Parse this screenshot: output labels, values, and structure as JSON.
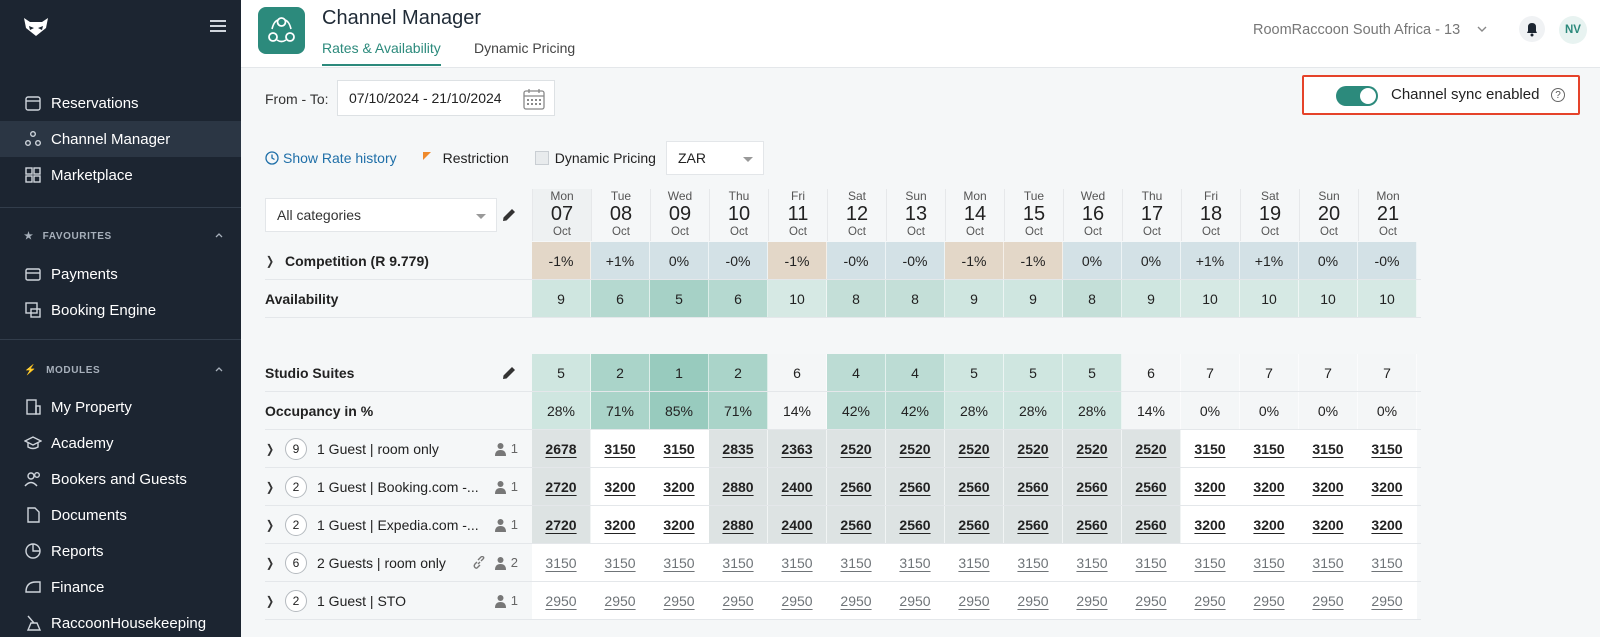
{
  "sidebar": {
    "nav_top": [
      "Reservations",
      "Channel Manager",
      "Marketplace"
    ],
    "favourites_title": "FAVOURITES",
    "favourites": [
      "Payments",
      "Booking Engine"
    ],
    "modules_title": "MODULES",
    "modules": [
      "My Property",
      "Academy",
      "Bookers and Guests",
      "Documents",
      "Reports",
      "Finance",
      "RaccoonHousekeeping"
    ]
  },
  "header": {
    "title": "Channel Manager",
    "tabs": [
      "Rates & Availability",
      "Dynamic Pricing"
    ],
    "property": "RoomRaccoon South Africa - 13",
    "avatar": "NV"
  },
  "controls": {
    "from_to_label": "From - To:",
    "date_range": "07/10/2024 - 21/10/2024",
    "sync_label": "Channel sync enabled",
    "sync_enabled": true,
    "show_rate_history": "Show Rate history",
    "restriction": "Restriction",
    "dynamic_pricing": "Dynamic Pricing",
    "currency": "ZAR",
    "category": "All categories"
  },
  "days": [
    {
      "dn": "Mon",
      "dd": "07",
      "dm": "Oct"
    },
    {
      "dn": "Tue",
      "dd": "08",
      "dm": "Oct"
    },
    {
      "dn": "Wed",
      "dd": "09",
      "dm": "Oct"
    },
    {
      "dn": "Thu",
      "dd": "10",
      "dm": "Oct"
    },
    {
      "dn": "Fri",
      "dd": "11",
      "dm": "Oct"
    },
    {
      "dn": "Sat",
      "dd": "12",
      "dm": "Oct"
    },
    {
      "dn": "Sun",
      "dd": "13",
      "dm": "Oct"
    },
    {
      "dn": "Mon",
      "dd": "14",
      "dm": "Oct"
    },
    {
      "dn": "Tue",
      "dd": "15",
      "dm": "Oct"
    },
    {
      "dn": "Wed",
      "dd": "16",
      "dm": "Oct"
    },
    {
      "dn": "Thu",
      "dd": "17",
      "dm": "Oct"
    },
    {
      "dn": "Fri",
      "dd": "18",
      "dm": "Oct"
    },
    {
      "dn": "Sat",
      "dd": "19",
      "dm": "Oct"
    },
    {
      "dn": "Sun",
      "dd": "20",
      "dm": "Oct"
    },
    {
      "dn": "Mon",
      "dd": "21",
      "dm": "Oct"
    }
  ],
  "rows": {
    "competition": {
      "label": "Competition (R 9.779)",
      "values": [
        "-1%",
        "+1%",
        "0%",
        "-0%",
        "-1%",
        "-0%",
        "-0%",
        "-1%",
        "-1%",
        "0%",
        "0%",
        "+1%",
        "+1%",
        "0%",
        "-0%"
      ],
      "colors": [
        "#e3d7c8",
        "#d3e1e6",
        "#d3e1e6",
        "#d3e1e6",
        "#e3d7c8",
        "#d3e1e6",
        "#d3e1e6",
        "#e3d7c8",
        "#e3d7c8",
        "#d3e1e6",
        "#d3e1e6",
        "#d3e1e6",
        "#d3e1e6",
        "#d3e1e6",
        "#d3e1e6"
      ]
    },
    "availability": {
      "label": "Availability",
      "values": [
        "9",
        "6",
        "5",
        "6",
        "10",
        "8",
        "8",
        "9",
        "9",
        "8",
        "9",
        "10",
        "10",
        "10",
        "10"
      ],
      "colors": [
        "#cfe6e0",
        "#b5d9d0",
        "#a6d1c6",
        "#b5d9d0",
        "#d6e9e4",
        "#c4dfd8",
        "#c4dfd8",
        "#cfe6e0",
        "#cfe6e0",
        "#c4dfd8",
        "#cfe6e0",
        "#d6e9e4",
        "#d6e9e4",
        "#d6e9e4",
        "#d6e9e4"
      ]
    },
    "studio": {
      "label": "Studio Suites",
      "values": [
        "5",
        "2",
        "1",
        "2",
        "6",
        "4",
        "4",
        "5",
        "5",
        "5",
        "6",
        "7",
        "7",
        "7",
        "7"
      ],
      "colors": [
        "#cfe6e0",
        "#aad4c9",
        "#98cbbe",
        "#aad4c9",
        "#f4f6f7",
        "#bcdcd4",
        "#bcdcd4",
        "#cfe6e0",
        "#cfe6e0",
        "#cfe6e0",
        "#f4f6f7",
        "#f4f6f7",
        "#f4f6f7",
        "#f4f6f7",
        "#f4f6f7"
      ]
    },
    "occupancy": {
      "label": "Occupancy in %",
      "values": [
        "28%",
        "71%",
        "85%",
        "71%",
        "14%",
        "42%",
        "42%",
        "28%",
        "28%",
        "28%",
        "14%",
        "0%",
        "0%",
        "0%",
        "0%"
      ],
      "colors": [
        "#cfe6e0",
        "#aad4c9",
        "#98cbbe",
        "#aad4c9",
        "#f4f6f7",
        "#bcdcd4",
        "#bcdcd4",
        "#cfe6e0",
        "#cfe6e0",
        "#cfe6e0",
        "#f4f6f7",
        "#f4f6f7",
        "#f4f6f7",
        "#f4f6f7",
        "#f4f6f7"
      ]
    }
  },
  "rates": [
    {
      "badge": "9",
      "label": "1 Guest | room only",
      "occ": "1",
      "link": false,
      "style": "b",
      "values": [
        "2678",
        "3150",
        "3150",
        "2835",
        "2363",
        "2520",
        "2520",
        "2520",
        "2520",
        "2520",
        "2520",
        "3150",
        "3150",
        "3150",
        "3150"
      ],
      "colors": [
        "#dde3e3",
        "#ffffff",
        "#ffffff",
        "#dde3e3",
        "#dde3e3",
        "#dde3e3",
        "#dde3e3",
        "#dde3e3",
        "#dde3e3",
        "#dde3e3",
        "#dde3e3",
        "#ffffff",
        "#ffffff",
        "#ffffff",
        "#ffffff"
      ]
    },
    {
      "badge": "2",
      "label": "1 Guest | Booking.com -...",
      "occ": "1",
      "link": false,
      "style": "b",
      "values": [
        "2720",
        "3200",
        "3200",
        "2880",
        "2400",
        "2560",
        "2560",
        "2560",
        "2560",
        "2560",
        "2560",
        "3200",
        "3200",
        "3200",
        "3200"
      ],
      "colors": [
        "#dde3e3",
        "#ffffff",
        "#ffffff",
        "#dde3e3",
        "#dde3e3",
        "#dde3e3",
        "#dde3e3",
        "#dde3e3",
        "#dde3e3",
        "#dde3e3",
        "#dde3e3",
        "#ffffff",
        "#ffffff",
        "#ffffff",
        "#ffffff"
      ]
    },
    {
      "badge": "2",
      "label": "1 Guest | Expedia.com -...",
      "occ": "1",
      "link": false,
      "style": "b",
      "values": [
        "2720",
        "3200",
        "3200",
        "2880",
        "2400",
        "2560",
        "2560",
        "2560",
        "2560",
        "2560",
        "2560",
        "3200",
        "3200",
        "3200",
        "3200"
      ],
      "colors": [
        "#dde3e3",
        "#ffffff",
        "#ffffff",
        "#dde3e3",
        "#dde3e3",
        "#dde3e3",
        "#dde3e3",
        "#dde3e3",
        "#dde3e3",
        "#dde3e3",
        "#dde3e3",
        "#ffffff",
        "#ffffff",
        "#ffffff",
        "#ffffff"
      ]
    },
    {
      "badge": "6",
      "label": "2 Guests | room only",
      "occ": "2",
      "link": true,
      "style": "g",
      "values": [
        "3150",
        "3150",
        "3150",
        "3150",
        "3150",
        "3150",
        "3150",
        "3150",
        "3150",
        "3150",
        "3150",
        "3150",
        "3150",
        "3150",
        "3150"
      ],
      "colors": [
        "#ffffff",
        "#ffffff",
        "#ffffff",
        "#ffffff",
        "#ffffff",
        "#ffffff",
        "#ffffff",
        "#ffffff",
        "#ffffff",
        "#ffffff",
        "#ffffff",
        "#ffffff",
        "#ffffff",
        "#ffffff",
        "#ffffff"
      ]
    },
    {
      "badge": "2",
      "label": "1 Guest | STO",
      "occ": "1",
      "link": false,
      "style": "g",
      "values": [
        "2950",
        "2950",
        "2950",
        "2950",
        "2950",
        "2950",
        "2950",
        "2950",
        "2950",
        "2950",
        "2950",
        "2950",
        "2950",
        "2950",
        "2950"
      ],
      "colors": [
        "#ffffff",
        "#ffffff",
        "#ffffff",
        "#ffffff",
        "#ffffff",
        "#ffffff",
        "#ffffff",
        "#ffffff",
        "#ffffff",
        "#ffffff",
        "#ffffff",
        "#ffffff",
        "#ffffff",
        "#ffffff",
        "#ffffff"
      ]
    }
  ],
  "colors": {
    "accent": "#2c8a7c",
    "sidebar": "#1c2531",
    "highlight": "#e5432a",
    "link": "#1f6fa8"
  }
}
